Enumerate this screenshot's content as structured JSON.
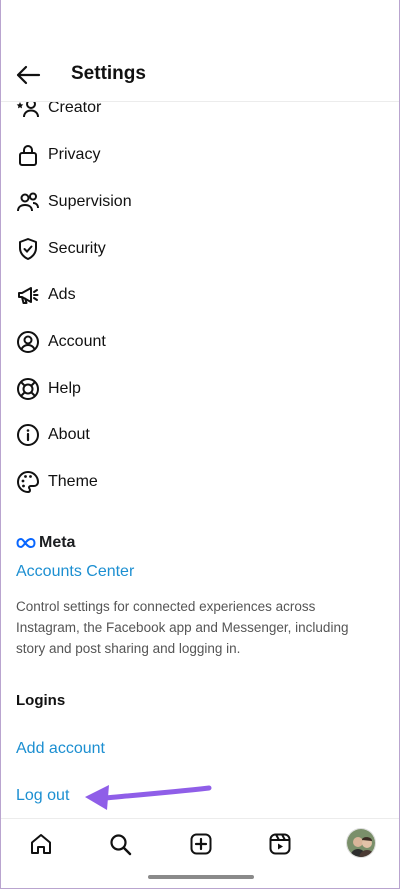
{
  "header": {
    "title": "Settings"
  },
  "menu": [
    {
      "label": "Creator",
      "icon": "creator-icon"
    },
    {
      "label": "Privacy",
      "icon": "lock-icon"
    },
    {
      "label": "Supervision",
      "icon": "supervision-icon"
    },
    {
      "label": "Security",
      "icon": "shield-icon"
    },
    {
      "label": "Ads",
      "icon": "megaphone-icon"
    },
    {
      "label": "Account",
      "icon": "account-icon"
    },
    {
      "label": "Help",
      "icon": "lifebuoy-icon"
    },
    {
      "label": "About",
      "icon": "info-icon"
    },
    {
      "label": "Theme",
      "icon": "palette-icon"
    }
  ],
  "meta": {
    "logo_text": "Meta",
    "accounts_center": "Accounts Center",
    "description": "Control settings for connected experiences across Instagram, the Facebook app and Messenger, including story and post sharing and logging in."
  },
  "logins": {
    "title": "Logins",
    "add_account": "Add account",
    "log_out": "Log out"
  },
  "colors": {
    "link": "#1c8fd1",
    "annotation_arrow": "#8f5ee8"
  },
  "bottom_nav": [
    "home-icon",
    "search-icon",
    "create-icon",
    "reels-icon",
    "profile-avatar"
  ]
}
